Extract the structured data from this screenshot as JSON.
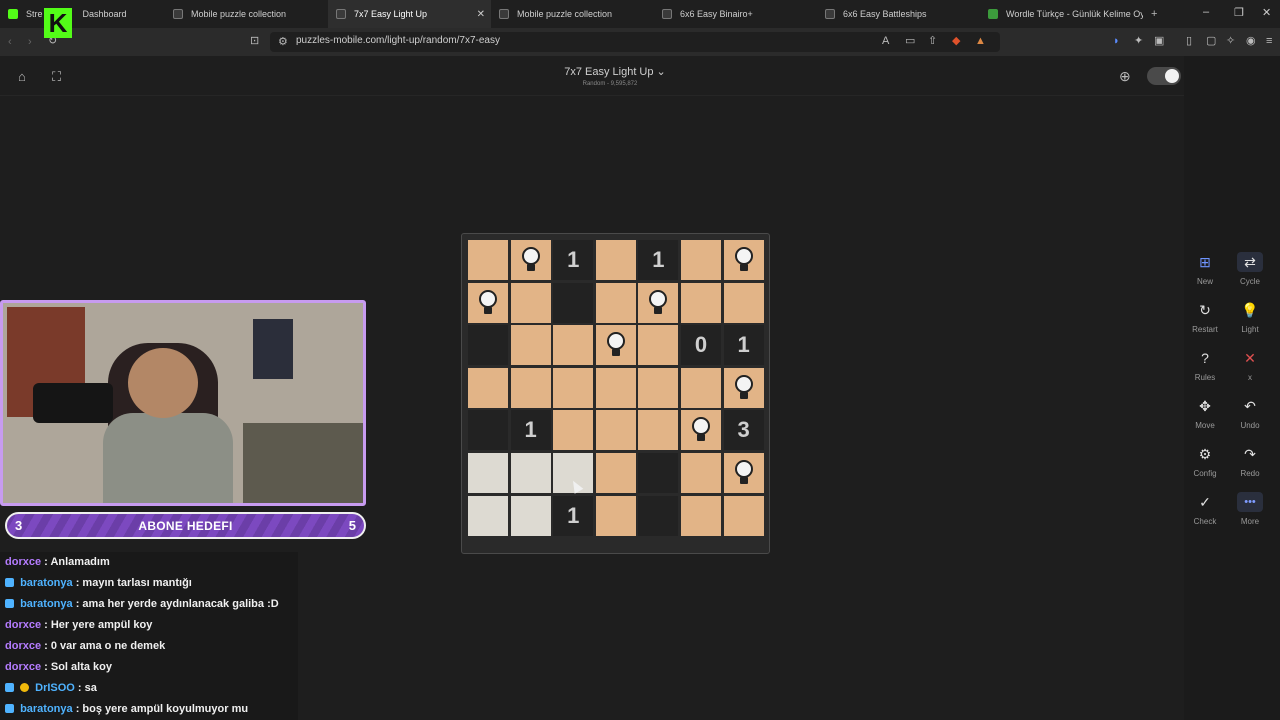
{
  "browser": {
    "tabs": [
      {
        "label": "Stre",
        "extra": "Dashboard",
        "active": false
      },
      {
        "label": "Mobile puzzle collection",
        "active": false
      },
      {
        "label": "7x7 Easy Light Up",
        "active": true
      },
      {
        "label": "Mobile puzzle collection",
        "active": false
      },
      {
        "label": "6x6 Easy Binairo+",
        "active": false
      },
      {
        "label": "6x6 Easy Battleships",
        "active": false
      },
      {
        "label": "Wordle Türkçe - Günlük Kelime Oyu",
        "active": false
      }
    ],
    "url": "puzzles-mobile.com/light-up/random/7x7-easy"
  },
  "header": {
    "title": "7x7 Easy Light Up ⌄",
    "subtitle": "Random - 9,595,872"
  },
  "sidebar": {
    "items": [
      {
        "label": "New",
        "icon": "⊞"
      },
      {
        "label": "Cycle",
        "icon": "⇄"
      },
      {
        "label": "Restart",
        "icon": "↻"
      },
      {
        "label": "Light",
        "icon": "💡"
      },
      {
        "label": "Rules",
        "icon": "?"
      },
      {
        "label": "x",
        "icon": "✕"
      },
      {
        "label": "Move",
        "icon": "✥"
      },
      {
        "label": "Undo",
        "icon": "↶"
      },
      {
        "label": "Config",
        "icon": "⚙"
      },
      {
        "label": "Redo",
        "icon": "↷"
      },
      {
        "label": "Check",
        "icon": "✓"
      },
      {
        "label": "More",
        "icon": "•••"
      }
    ]
  },
  "board": {
    "size": 7,
    "rows": [
      [
        "L",
        "LB",
        "1",
        "L",
        "1",
        "L",
        "LB"
      ],
      [
        "LB",
        "L",
        "#",
        "L",
        "LB",
        "L",
        "L"
      ],
      [
        "#",
        "L",
        "L",
        "LB",
        "L",
        "0",
        "1"
      ],
      [
        "L",
        "L",
        "L",
        "L",
        "L",
        "L",
        "LB"
      ],
      [
        "#",
        "1",
        "L",
        "L",
        "L",
        "LB",
        "3"
      ],
      [
        "W",
        "W",
        "W",
        "L",
        "#",
        "L",
        "LB"
      ],
      [
        "W",
        "W",
        "1",
        "L",
        "#",
        "L",
        "L"
      ]
    ]
  },
  "stream": {
    "logo": "K",
    "goal": {
      "current": "3",
      "label": "ABONE HEDEFI",
      "target": "5"
    },
    "chat": [
      {
        "user": "dorxce",
        "color": "purple",
        "badge": false,
        "text": ": Anlamadım"
      },
      {
        "user": "baratonya",
        "color": "blue",
        "badge": true,
        "text": ": mayın tarlası mantığı"
      },
      {
        "user": "baratonya",
        "color": "blue",
        "badge": true,
        "text": ": ama her yerde aydınlanacak galiba :D"
      },
      {
        "user": "dorxce",
        "color": "purple",
        "badge": false,
        "text": ": Her yere ampül koy"
      },
      {
        "user": "dorxce",
        "color": "purple",
        "badge": false,
        "text": ": 0 var ama o ne demek"
      },
      {
        "user": "dorxce",
        "color": "purple",
        "badge": false,
        "text": ": Sol alta koy"
      },
      {
        "user": "DrISOO",
        "color": "blue",
        "badge": true,
        "badge2": true,
        "text": ": sa"
      },
      {
        "user": "baratonya",
        "color": "blue",
        "badge": true,
        "text": ": boş yere ampül koyulmuyor mu"
      }
    ]
  }
}
